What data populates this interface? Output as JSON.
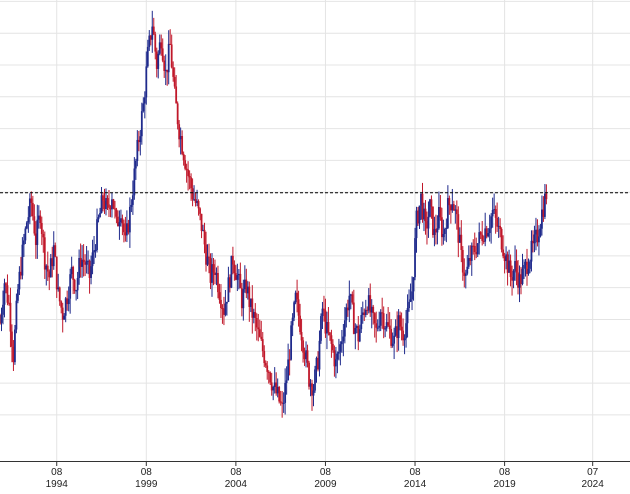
{
  "chart_data": {
    "type": "candlestick",
    "title": "",
    "xlabel": "",
    "ylabel": "",
    "x_range": [
      "1991-06",
      "2026-08"
    ],
    "y_range_relative": [
      0,
      100
    ],
    "grid": true,
    "legend": "none",
    "colors": {
      "up": "#1f2a8c",
      "down": "#c0182a",
      "grid": "#e4e4e4",
      "axis": "#333333",
      "reference_line": "#000000"
    },
    "reference_line": {
      "style": "dashed",
      "value": 58.2
    },
    "x_ticks": [
      {
        "month": "08",
        "year": "1994",
        "date": "1994-08"
      },
      {
        "month": "08",
        "year": "1999",
        "date": "1999-08"
      },
      {
        "month": "08",
        "year": "2004",
        "date": "2004-08"
      },
      {
        "month": "08",
        "year": "2009",
        "date": "2009-08"
      },
      {
        "month": "08",
        "year": "2014",
        "date": "2014-08"
      },
      {
        "month": "08",
        "year": "2019",
        "date": "2019-08"
      },
      {
        "month": "07",
        "year": "2024",
        "date": "2024-07"
      }
    ],
    "note": "y values are relative positions (0 = bottom of plot, 100 = top); the axis prints no y tick labels",
    "series": [
      {
        "values": [
          [
            "1991-06",
            30
          ],
          [
            "1991-09",
            39
          ],
          [
            "1991-12",
            34
          ],
          [
            "1992-03",
            23
          ],
          [
            "1992-06",
            37
          ],
          [
            "1992-09",
            45
          ],
          [
            "1992-12",
            52
          ],
          [
            "1993-03",
            56
          ],
          [
            "1993-06",
            48
          ],
          [
            "1993-09",
            54
          ],
          [
            "1993-12",
            44
          ],
          [
            "1994-03",
            40
          ],
          [
            "1994-06",
            46
          ],
          [
            "1994-09",
            36
          ],
          [
            "1994-12",
            32
          ],
          [
            "1995-03",
            36
          ],
          [
            "1995-06",
            41
          ],
          [
            "1995-09",
            38
          ],
          [
            "1995-12",
            44
          ],
          [
            "1996-03",
            43
          ],
          [
            "1996-06",
            40
          ],
          [
            "1996-09",
            46
          ],
          [
            "1996-12",
            52
          ],
          [
            "1997-03",
            57
          ],
          [
            "1997-06",
            54
          ],
          [
            "1997-09",
            58
          ],
          [
            "1997-12",
            51
          ],
          [
            "1998-03",
            55
          ],
          [
            "1998-06",
            47
          ],
          [
            "1998-09",
            54
          ],
          [
            "1998-12",
            62
          ],
          [
            "1999-03",
            70
          ],
          [
            "1999-06",
            77
          ],
          [
            "1999-09",
            88
          ],
          [
            "1999-12",
            95
          ],
          [
            "2000-03",
            86
          ],
          [
            "2000-06",
            92
          ],
          [
            "2000-09",
            84
          ],
          [
            "2000-12",
            90
          ],
          [
            "2001-03",
            79
          ],
          [
            "2001-06",
            72
          ],
          [
            "2001-09",
            67
          ],
          [
            "2001-12",
            62
          ],
          [
            "2002-03",
            58
          ],
          [
            "2002-06",
            55
          ],
          [
            "2002-09",
            51
          ],
          [
            "2002-12",
            45
          ],
          [
            "2003-03",
            40
          ],
          [
            "2003-06",
            42
          ],
          [
            "2003-09",
            37
          ],
          [
            "2003-12",
            33
          ],
          [
            "2004-03",
            38
          ],
          [
            "2004-06",
            44
          ],
          [
            "2004-09",
            40
          ],
          [
            "2004-12",
            35
          ],
          [
            "2005-03",
            38
          ],
          [
            "2005-06",
            33
          ],
          [
            "2005-09",
            30
          ],
          [
            "2005-12",
            26
          ],
          [
            "2006-03",
            23
          ],
          [
            "2006-06",
            20
          ],
          [
            "2006-09",
            16
          ],
          [
            "2006-12",
            14
          ],
          [
            "2007-03",
            11
          ],
          [
            "2007-06",
            18
          ],
          [
            "2007-09",
            27
          ],
          [
            "2007-12",
            35
          ],
          [
            "2008-03",
            30
          ],
          [
            "2008-06",
            24
          ],
          [
            "2008-09",
            18
          ],
          [
            "2008-12",
            16
          ],
          [
            "2009-03",
            22
          ],
          [
            "2009-06",
            33
          ],
          [
            "2009-09",
            28
          ],
          [
            "2009-12",
            25
          ],
          [
            "2010-03",
            21
          ],
          [
            "2010-06",
            25
          ],
          [
            "2010-09",
            31
          ],
          [
            "2010-12",
            36
          ],
          [
            "2011-03",
            30
          ],
          [
            "2011-06",
            27
          ],
          [
            "2011-09",
            32
          ],
          [
            "2011-12",
            35
          ],
          [
            "2012-03",
            31
          ],
          [
            "2012-06",
            28
          ],
          [
            "2012-09",
            33
          ],
          [
            "2012-12",
            30
          ],
          [
            "2013-03",
            28
          ],
          [
            "2013-06",
            26
          ],
          [
            "2013-09",
            30
          ],
          [
            "2013-12",
            28
          ],
          [
            "2014-03",
            31
          ],
          [
            "2014-06",
            37
          ],
          [
            "2014-09",
            52
          ],
          [
            "2014-12",
            57
          ],
          [
            "2015-03",
            50
          ],
          [
            "2015-06",
            55
          ],
          [
            "2015-09",
            49
          ],
          [
            "2015-12",
            53
          ],
          [
            "2016-03",
            49
          ],
          [
            "2016-06",
            55
          ],
          [
            "2016-09",
            57
          ],
          [
            "2016-12",
            52
          ],
          [
            "2017-03",
            44
          ],
          [
            "2017-06",
            40
          ],
          [
            "2017-09",
            44
          ],
          [
            "2017-12",
            46
          ],
          [
            "2018-03",
            48
          ],
          [
            "2018-06",
            50
          ],
          [
            "2018-09",
            51
          ],
          [
            "2018-12",
            54
          ],
          [
            "2019-03",
            51
          ],
          [
            "2019-06",
            48
          ],
          [
            "2019-09",
            44
          ],
          [
            "2019-12",
            40
          ],
          [
            "2020-03",
            42
          ],
          [
            "2020-06",
            39
          ],
          [
            "2020-09",
            41
          ],
          [
            "2020-12",
            44
          ],
          [
            "2021-03",
            46
          ],
          [
            "2021-06",
            49
          ],
          [
            "2021-09",
            54
          ],
          [
            "2021-12",
            58
          ]
        ]
      }
    ]
  }
}
